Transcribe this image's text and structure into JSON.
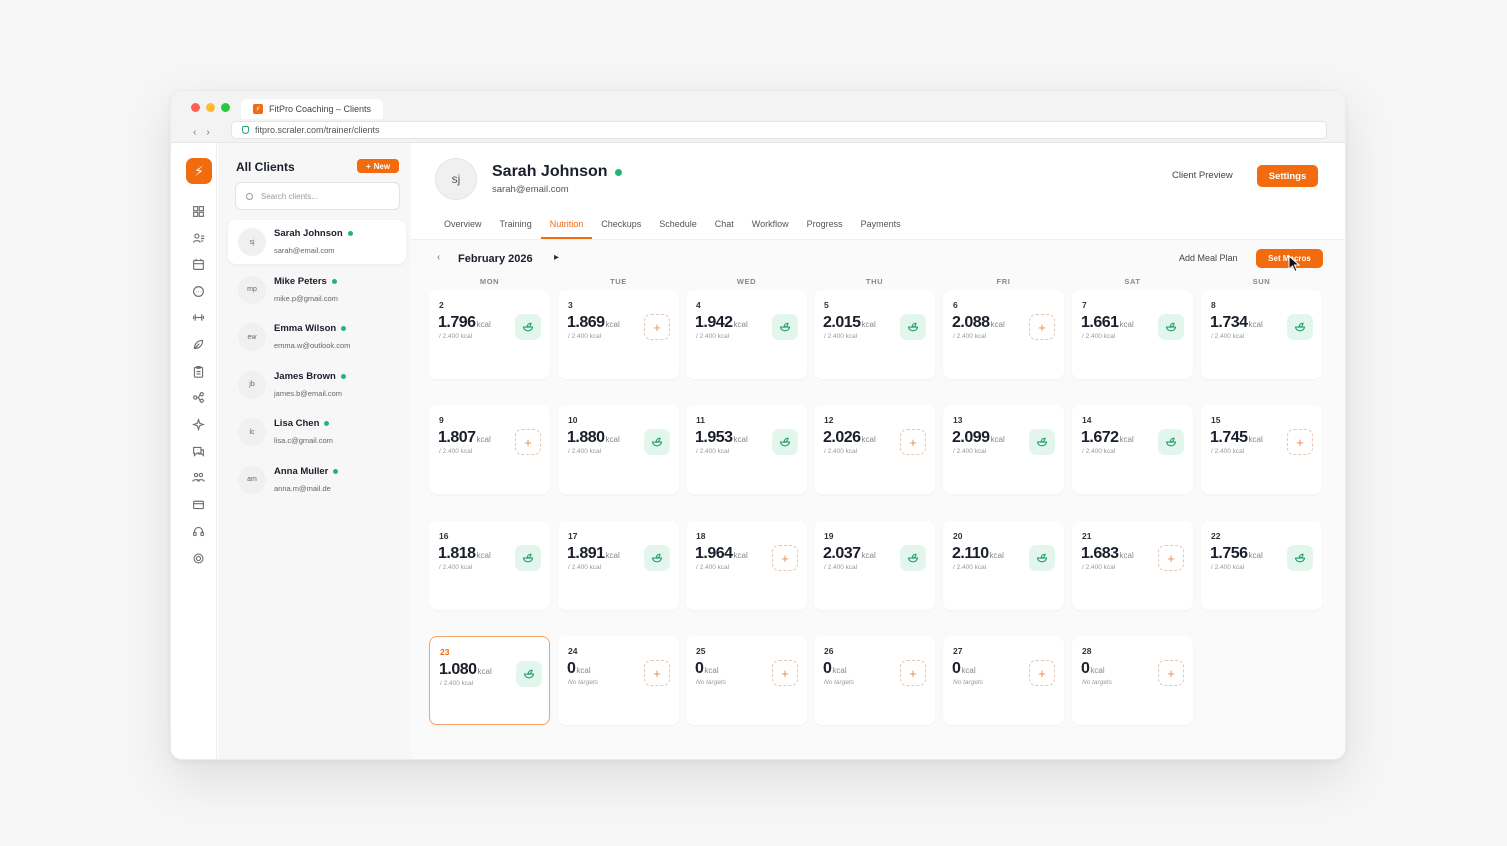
{
  "browser": {
    "tab_title": "FitPro Coaching – Clients",
    "url": "fitpro.scraler.com/trainer/clients",
    "dot_colors": [
      "#ff5f57",
      "#febc2e",
      "#28c840"
    ]
  },
  "brand": {
    "accent": "#f26b0f",
    "success": "#22b573",
    "logo_glyph": "⚡"
  },
  "rail": {
    "icons": [
      "dashboard-icon",
      "clients-icon",
      "calendar-icon",
      "chat-icon",
      "dumbbell-icon",
      "nutrition-icon",
      "clipboard-icon",
      "workflow-icon",
      "sparkle-icon",
      "messages-icon",
      "community-icon",
      "billing-icon",
      "support-icon",
      "settings-icon"
    ]
  },
  "clients_panel": {
    "title": "All Clients",
    "new_label": "New",
    "search_placeholder": "Search clients...",
    "clients": [
      {
        "initials": "sj",
        "name": "Sarah Johnson",
        "email": "sarah@email.com",
        "online": true
      },
      {
        "initials": "mp",
        "name": "Mike Peters",
        "email": "mike.p@gmail.com",
        "online": true
      },
      {
        "initials": "ew",
        "name": "Emma Wilson",
        "email": "emma.w@outlook.com",
        "online": true
      },
      {
        "initials": "jb",
        "name": "James Brown",
        "email": "james.b@email.com",
        "online": true
      },
      {
        "initials": "lc",
        "name": "Lisa Chen",
        "email": "lisa.c@gmail.com",
        "online": true
      },
      {
        "initials": "am",
        "name": "Anna Muller",
        "email": "anna.m@mail.de",
        "online": true
      }
    ]
  },
  "profile": {
    "initials": "sj",
    "name": "Sarah Johnson",
    "email": "sarah@email.com",
    "preview_label": "Client Preview",
    "settings_label": "Settings"
  },
  "tabs": [
    "Overview",
    "Training",
    "Nutrition",
    "Checkups",
    "Schedule",
    "Chat",
    "Workflow",
    "Progress",
    "Payments"
  ],
  "active_tab": "Nutrition",
  "calendar": {
    "month": "February 2026",
    "add_meal_label": "Add Meal Plan",
    "set_macros_label": "Set Macros",
    "weekdays": [
      "MON",
      "TUE",
      "WED",
      "THU",
      "FRI",
      "SAT",
      "SUN"
    ],
    "unit": "kcal",
    "days": [
      {
        "num": "2",
        "kcal": "1.796",
        "target": "/ 2.400 kcal",
        "action": "meal"
      },
      {
        "num": "3",
        "kcal": "1.869",
        "target": "/ 2.400 kcal",
        "action": "add"
      },
      {
        "num": "4",
        "kcal": "1.942",
        "target": "/ 2.400 kcal",
        "action": "meal"
      },
      {
        "num": "5",
        "kcal": "2.015",
        "target": "/ 2.400 kcal",
        "action": "meal"
      },
      {
        "num": "6",
        "kcal": "2.088",
        "target": "/ 2.400 kcal",
        "action": "add"
      },
      {
        "num": "7",
        "kcal": "1.661",
        "target": "/ 2.400 kcal",
        "action": "meal"
      },
      {
        "num": "8",
        "kcal": "1.734",
        "target": "/ 2.400 kcal",
        "action": "meal"
      },
      {
        "num": "9",
        "kcal": "1.807",
        "target": "/ 2.400 kcal",
        "action": "add"
      },
      {
        "num": "10",
        "kcal": "1.880",
        "target": "/ 2.400 kcal",
        "action": "meal"
      },
      {
        "num": "11",
        "kcal": "1.953",
        "target": "/ 2.400 kcal",
        "action": "meal"
      },
      {
        "num": "12",
        "kcal": "2.026",
        "target": "/ 2.400 kcal",
        "action": "add"
      },
      {
        "num": "13",
        "kcal": "2.099",
        "target": "/ 2.400 kcal",
        "action": "meal"
      },
      {
        "num": "14",
        "kcal": "1.672",
        "target": "/ 2.400 kcal",
        "action": "meal"
      },
      {
        "num": "15",
        "kcal": "1.745",
        "target": "/ 2.400 kcal",
        "action": "add"
      },
      {
        "num": "16",
        "kcal": "1.818",
        "target": "/ 2.400 kcal",
        "action": "meal"
      },
      {
        "num": "17",
        "kcal": "1.891",
        "target": "/ 2.400 kcal",
        "action": "meal"
      },
      {
        "num": "18",
        "kcal": "1.964",
        "target": "/ 2.400 kcal",
        "action": "add"
      },
      {
        "num": "19",
        "kcal": "2.037",
        "target": "/ 2.400 kcal",
        "action": "meal"
      },
      {
        "num": "20",
        "kcal": "2.110",
        "target": "/ 2.400 kcal",
        "action": "meal"
      },
      {
        "num": "21",
        "kcal": "1.683",
        "target": "/ 2.400 kcal",
        "action": "add"
      },
      {
        "num": "22",
        "kcal": "1.756",
        "target": "/ 2.400 kcal",
        "action": "meal"
      },
      {
        "num": "23",
        "kcal": "1.080",
        "target": "/ 2.400 kcal",
        "action": "meal",
        "today": true
      },
      {
        "num": "24",
        "kcal": "0",
        "target": "No targets",
        "action": "add"
      },
      {
        "num": "25",
        "kcal": "0",
        "target": "No targets",
        "action": "add"
      },
      {
        "num": "26",
        "kcal": "0",
        "target": "No targets",
        "action": "add"
      },
      {
        "num": "27",
        "kcal": "0",
        "target": "No targets",
        "action": "add"
      },
      {
        "num": "28",
        "kcal": "0",
        "target": "No targets",
        "action": "add"
      }
    ]
  }
}
